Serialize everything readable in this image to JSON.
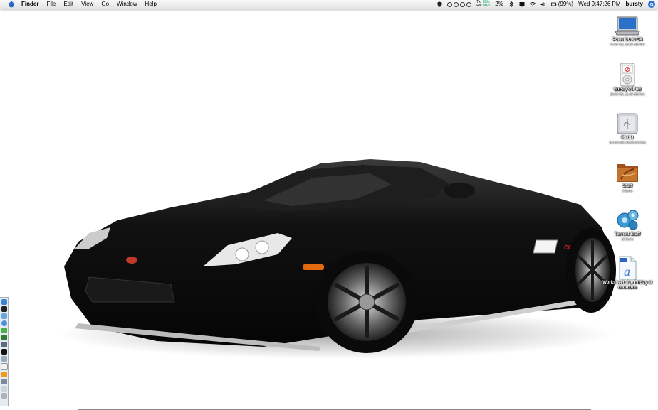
{
  "menubar": {
    "app_name": "Finder",
    "menus": [
      "File",
      "Edit",
      "View",
      "Go",
      "Window",
      "Help"
    ],
    "status": {
      "net_tx_label": "Tx:",
      "net_rx_label": "Rx:",
      "net_tx": "0B/s",
      "net_rx": "0B/s",
      "cpu": "2%",
      "battery": "(99%)",
      "clock": "Wed 9:47:26 PM",
      "user": "bursty"
    }
  },
  "desktop_items": [
    {
      "name": "Powerbook G4",
      "sub": "74.92 GB, 15.61 GB free"
    },
    {
      "name": "bursty's iPod",
      "sub": "18.68 GB, 11.69 GB free"
    },
    {
      "name": "Media",
      "sub": "111.64 GB, 53.05 GB free"
    },
    {
      "name": "Stuff",
      "sub": "8 items"
    },
    {
      "name": "Torrent Stuff",
      "sub": "10 items"
    },
    {
      "name": "Worksheet due Friday at noon.doc",
      "sub": ""
    }
  ],
  "wallpaper": {
    "badge_text": "CCX",
    "accent_color": "#d42020",
    "car_color": "#0a0a0a"
  },
  "dock": {
    "position": "left",
    "icons": [
      "finder-icon",
      "dashboard-icon",
      "mail-icon",
      "safari-icon",
      "ichat-icon",
      "itunes-icon",
      "iphoto-icon",
      "terminal-icon",
      "preview-icon",
      "textedit-icon",
      "vlc-icon",
      "system-preferences-icon",
      "documents-icon",
      "trash-icon"
    ]
  }
}
